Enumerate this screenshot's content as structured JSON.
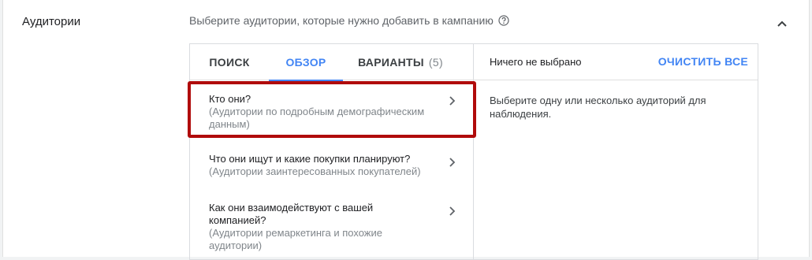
{
  "section": {
    "title": "Аудитории",
    "instruction": "Выберите аудитории, которые нужно добавить в кампанию",
    "help_icon": "help-circle-icon",
    "collapse_icon": "chevron-up-icon"
  },
  "tabs": [
    {
      "label": "ПОИСК",
      "active": false
    },
    {
      "label": "ОБЗОР",
      "active": true
    },
    {
      "label": "ВАРИАНТЫ",
      "count": "(5)",
      "active": false
    }
  ],
  "items": [
    {
      "title": "Кто они?",
      "subtitle": "(Аудитории по подробным демографическим данным)"
    },
    {
      "title": "Что они ищут и какие покупки планируют?",
      "subtitle": "(Аудитории заинтересованных покупателей)"
    },
    {
      "title": "Как они взаимодействуют с вашей компанией?",
      "subtitle": "(Аудитории ремаркетинга и похожие аудитории)"
    }
  ],
  "selection": {
    "empty_text": "Ничего не выбрано",
    "clear_label": "ОЧИСТИТЬ ВСЕ",
    "hint": "Выберите одну или несколько аудиторий для наблюдения."
  },
  "colors": {
    "accent": "#4285f4",
    "highlight": "#b00b0b"
  }
}
